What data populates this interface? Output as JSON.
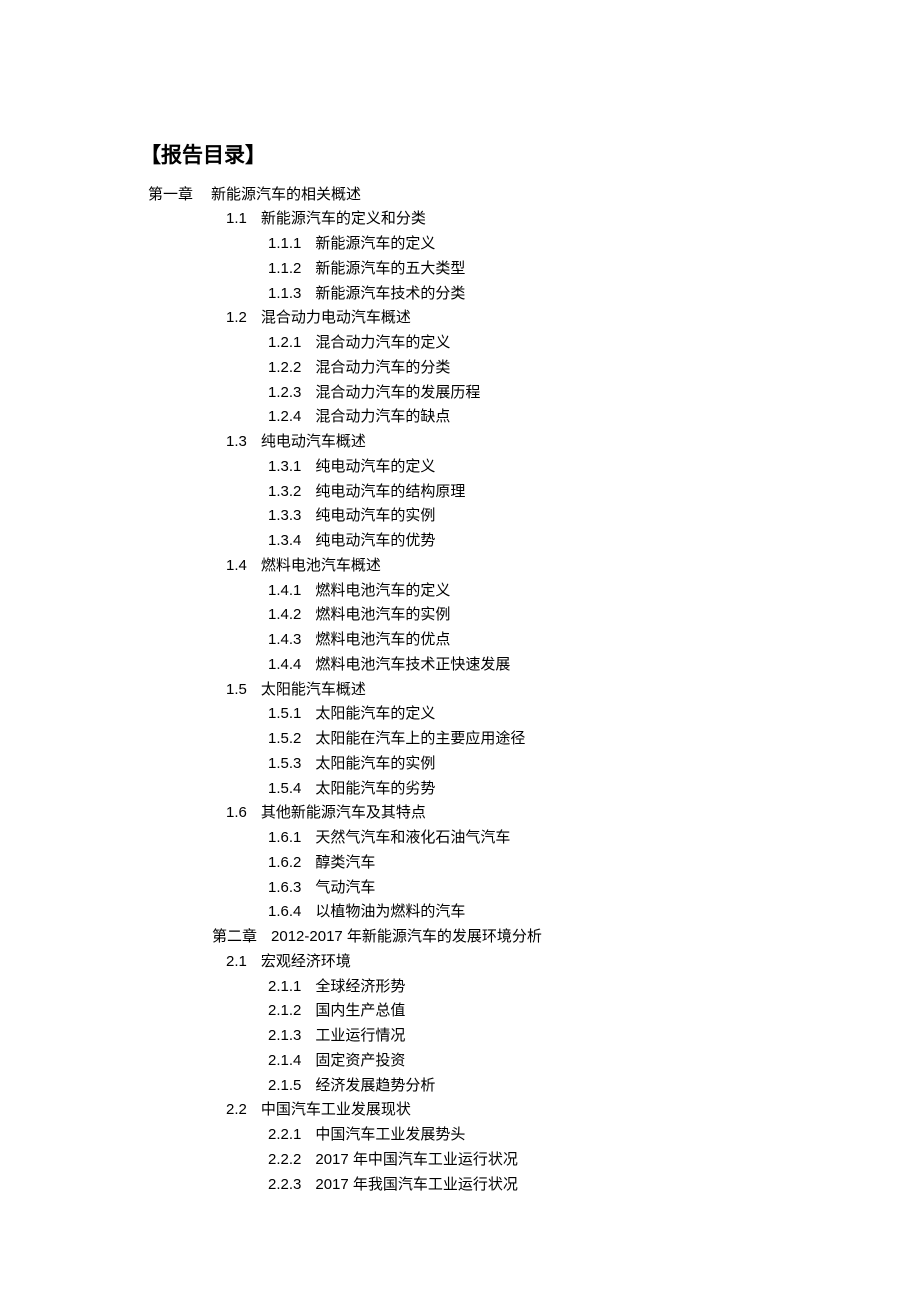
{
  "title": "【报告目录】",
  "ch1": {
    "num": "第一章",
    "title": "新能源汽车的相关概述"
  },
  "s11": {
    "num": "1.1",
    "title": "新能源汽车的定义和分类"
  },
  "s111": {
    "num": "1.1.1",
    "title": "新能源汽车的定义"
  },
  "s112": {
    "num": "1.1.2",
    "title": "新能源汽车的五大类型"
  },
  "s113": {
    "num": "1.1.3",
    "title": "新能源汽车技术的分类"
  },
  "s12": {
    "num": "1.2",
    "title": "混合动力电动汽车概述"
  },
  "s121": {
    "num": "1.2.1",
    "title": "混合动力汽车的定义"
  },
  "s122": {
    "num": "1.2.2",
    "title": "混合动力汽车的分类"
  },
  "s123": {
    "num": "1.2.3",
    "title": "混合动力汽车的发展历程"
  },
  "s124": {
    "num": "1.2.4",
    "title": "混合动力汽车的缺点"
  },
  "s13": {
    "num": "1.3",
    "title": "纯电动汽车概述"
  },
  "s131": {
    "num": "1.3.1",
    "title": "纯电动汽车的定义"
  },
  "s132": {
    "num": "1.3.2",
    "title": "纯电动汽车的结构原理"
  },
  "s133": {
    "num": "1.3.3",
    "title": "纯电动汽车的实例"
  },
  "s134": {
    "num": "1.3.4",
    "title": "纯电动汽车的优势"
  },
  "s14": {
    "num": "1.4",
    "title": "燃料电池汽车概述"
  },
  "s141": {
    "num": "1.4.1",
    "title": "燃料电池汽车的定义"
  },
  "s142": {
    "num": "1.4.2",
    "title": "燃料电池汽车的实例"
  },
  "s143": {
    "num": "1.4.3",
    "title": "燃料电池汽车的优点"
  },
  "s144": {
    "num": "1.4.4",
    "title": "燃料电池汽车技术正快速发展"
  },
  "s15": {
    "num": "1.5",
    "title": "太阳能汽车概述"
  },
  "s151": {
    "num": "1.5.1",
    "title": "太阳能汽车的定义"
  },
  "s152": {
    "num": "1.5.2",
    "title": "太阳能在汽车上的主要应用途径"
  },
  "s153": {
    "num": "1.5.3",
    "title": "太阳能汽车的实例"
  },
  "s154": {
    "num": "1.5.4",
    "title": "太阳能汽车的劣势"
  },
  "s16": {
    "num": "1.6",
    "title": "其他新能源汽车及其特点"
  },
  "s161": {
    "num": "1.6.1",
    "title": "天然气汽车和液化石油气汽车"
  },
  "s162": {
    "num": "1.6.2",
    "title": "醇类汽车"
  },
  "s163": {
    "num": "1.6.3",
    "title": "气动汽车"
  },
  "s164": {
    "num": "1.6.4",
    "title": "以植物油为燃料的汽车"
  },
  "ch2": {
    "num": "第二章",
    "title": "2012-2017 年新能源汽车的发展环境分析"
  },
  "s21": {
    "num": "2.1",
    "title": "宏观经济环境"
  },
  "s211": {
    "num": "2.1.1",
    "title": "全球经济形势"
  },
  "s212": {
    "num": "2.1.2",
    "title": "国内生产总值"
  },
  "s213": {
    "num": "2.1.3",
    "title": "工业运行情况"
  },
  "s214": {
    "num": "2.1.4",
    "title": "固定资产投资"
  },
  "s215": {
    "num": "2.1.5",
    "title": "经济发展趋势分析"
  },
  "s22": {
    "num": "2.2",
    "title": "中国汽车工业发展现状"
  },
  "s221": {
    "num": "2.2.1",
    "title": "中国汽车工业发展势头"
  },
  "s222": {
    "num": "2.2.2",
    "title": "2017 年中国汽车工业运行状况"
  },
  "s223": {
    "num": "2.2.3",
    "title": "2017 年我国汽车工业运行状况"
  }
}
